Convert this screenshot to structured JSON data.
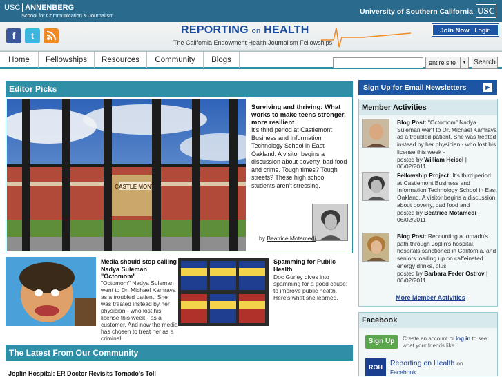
{
  "header": {
    "usc": "USC",
    "annenberg": "ANNENBERG",
    "school": "School for Communication & Journalism",
    "university": "University of Southern California",
    "usc_logo": "USC"
  },
  "banner": {
    "social_icons": [
      "facebook-icon",
      "twitter-icon",
      "rss-icon"
    ],
    "brand_reporting": "REPORTING",
    "brand_on": "on",
    "brand_health": "HEALTH",
    "brand_sub": "The California Endowment Health Journalism Fellowships",
    "join": "Join Now",
    "login": "Login"
  },
  "nav": {
    "items": [
      "Home",
      "Fellowships",
      "Resources",
      "Community",
      "Blogs"
    ],
    "search_placeholder": "",
    "scope": "entire site",
    "search_button": "Search"
  },
  "editor_picks": {
    "heading": "Editor Picks",
    "hero": {
      "title": "Surviving and thriving: What works to make teens stronger, more resilient",
      "text": "It's third period at Castlemont Business and Information Technology School in East Oakland. A visitor begins a discussion about poverty, bad food and crime. Tough times? Tough streets? These high school students aren't stressing.",
      "by_label": "by",
      "author": "Beatrice Motamedi",
      "sign_text": "CASTLE MONT"
    },
    "stories": [
      {
        "title": "Media should stop calling Nadya Suleman \"Octomom\"",
        "text": "\"Octomom\" Nadya Suleman went to Dr. Michael Kamrava as a troubled patient. She was treated instead by her physician - who lost his license this week - as a customer. And now the media has chosen to treat her as a criminal."
      },
      {
        "title": "Spamming for Public Health",
        "text": "Doc Gurley dives into spamming for a good cause: to improve public health. Here's what she learned."
      }
    ]
  },
  "latest": {
    "heading": "The Latest From Our Community",
    "first_title": "Joplin Hospital: ER Doctor Revisits Tornado's Toll"
  },
  "sidebar": {
    "email_button": "Sign Up for Email Newsletters",
    "member_activities": {
      "heading": "Member Activities",
      "items": [
        {
          "type": "Blog Post:",
          "text": "\"Octomom\" Nadya Suleman went to Dr. Michael Kamrava as a troubled patient. She was treated instead by her physician - who lost his license this week -",
          "posted_by": "posted by",
          "author": "William Heisel",
          "date": "| 06/02/2011"
        },
        {
          "type": "Fellowship Project:",
          "text": "It's third period at Castlemont Business and Information Technology School in East Oakland. A visitor begins a discussion about poverty, bad food and",
          "posted_by": "posted by",
          "author": "Beatrice Motamedi",
          "date": "| 06/02/2011"
        },
        {
          "type": "Blog Post:",
          "text": "Recounting a tornado's path through Joplin's hospital, hospitals sanctioned in California, and seniors loading up on caffeinated energy drinks, plus",
          "posted_by": "posted by",
          "author": "Barbara Feder Ostrov",
          "date": "| 06/02/2011"
        }
      ],
      "more": "More Member Activities"
    },
    "facebook": {
      "heading": "Facebook",
      "signup": "Sign Up",
      "text_before": "Create an account or",
      "login": "log in",
      "text_after": "to see what your friends like.",
      "logo": "ROH",
      "page_name": "Reporting on Health",
      "on": "on",
      "page_fb": "Facebook"
    }
  }
}
